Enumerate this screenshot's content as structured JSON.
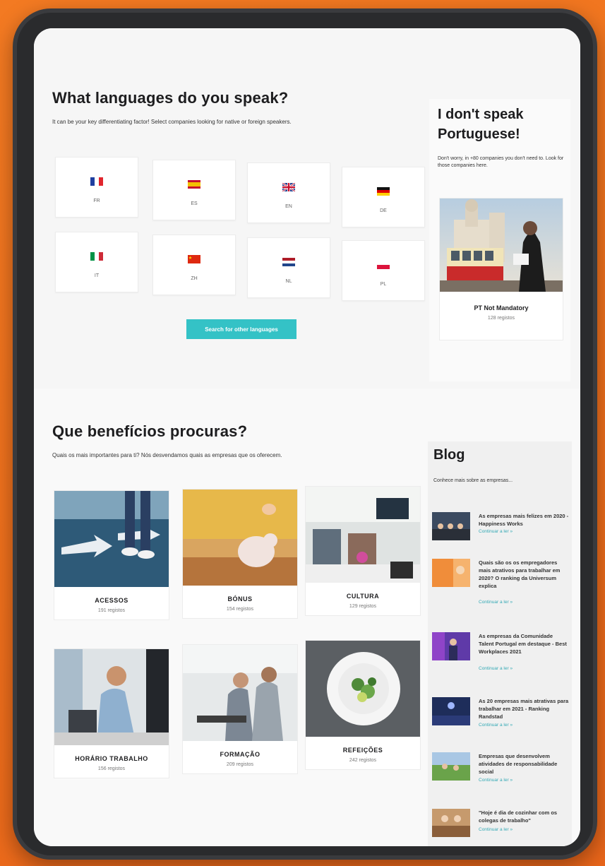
{
  "languages_section": {
    "title": "What languages do you speak?",
    "subtitle": "It can be your key differentiating factor! Select companies looking for native or foreign speakers.",
    "languages": [
      {
        "code": "FR",
        "flag": "france-flag-icon"
      },
      {
        "code": "ES",
        "flag": "spain-flag-icon"
      },
      {
        "code": "EN",
        "flag": "uk-flag-icon"
      },
      {
        "code": "DE",
        "flag": "germany-flag-icon"
      },
      {
        "code": "IT",
        "flag": "italy-flag-icon"
      },
      {
        "code": "ZH",
        "flag": "china-flag-icon"
      },
      {
        "code": "NL",
        "flag": "netherlands-flag-icon"
      },
      {
        "code": "PL",
        "flag": "poland-flag-icon"
      }
    ],
    "search_button": "Search for other languages",
    "accent_color": "#34c2c6"
  },
  "portuguese_box": {
    "title": "I don't speak Portuguese!",
    "text": "Don't worry, in +80 companies you don't need to. Look for those companies here.",
    "card": {
      "name": "PT Not Mandatory",
      "count": "128 registos"
    }
  },
  "benefits_section": {
    "title": "Que benefícios procuras?",
    "subtitle": "Quais os mais importantes para ti? Nós desvendamos quais as empresas que os oferecem.",
    "benefits": [
      {
        "name": "ACESSOS",
        "count": "191 registos"
      },
      {
        "name": "BÓNUS",
        "count": "154 registos"
      },
      {
        "name": "CULTURA",
        "count": "129 registos"
      },
      {
        "name": "HORÁRIO TRABALHO",
        "count": "156 registos"
      },
      {
        "name": "FORMAÇÃO",
        "count": "209 registos"
      },
      {
        "name": "REFEIÇÕES",
        "count": "242 registos"
      }
    ]
  },
  "blog": {
    "title": "Blog",
    "subtitle": "Conhece mais sobre as empresas...",
    "link_label": "Continuar a ler »",
    "posts": [
      {
        "title": "As empresas mais felizes em 2020 - Happiness Works"
      },
      {
        "title": "Quais são os os empregadores mais atrativos para trabalhar em 2020? O ranking da Universum explica"
      },
      {
        "title": "As empresas da Comunidade Talent Portugal em destaque - Best Workplaces 2021"
      },
      {
        "title": "As 20 empresas mais atrativas para trabalhar em 2021 - Ranking Randstad"
      },
      {
        "title": "Empresas que desenvolvem atividades de responsabilidade social"
      },
      {
        "title": "\"Hoje é dia de cozinhar com os colegas de trabalho\""
      }
    ],
    "link_color": "#34a9b5"
  }
}
